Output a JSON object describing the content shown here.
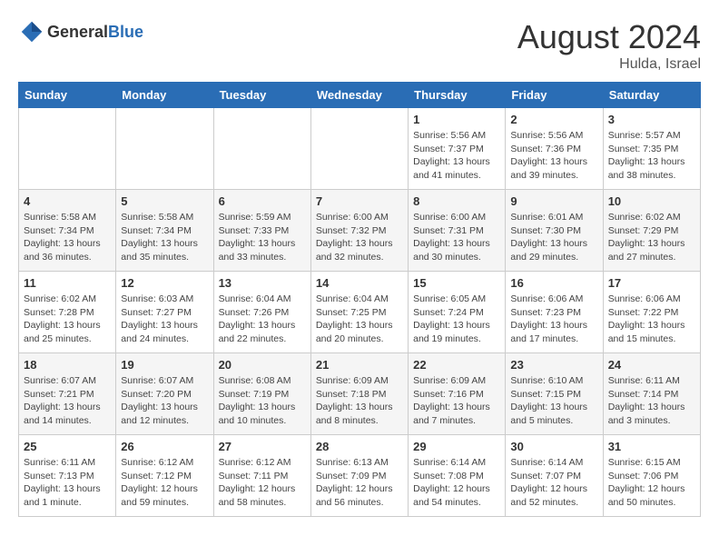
{
  "header": {
    "logo_general": "General",
    "logo_blue": "Blue",
    "month_year": "August 2024",
    "location": "Hulda, Israel"
  },
  "days_of_week": [
    "Sunday",
    "Monday",
    "Tuesday",
    "Wednesday",
    "Thursday",
    "Friday",
    "Saturday"
  ],
  "weeks": [
    [
      {
        "day": "",
        "empty": true
      },
      {
        "day": "",
        "empty": true
      },
      {
        "day": "",
        "empty": true
      },
      {
        "day": "",
        "empty": true
      },
      {
        "day": "1",
        "sunrise": "5:56 AM",
        "sunset": "7:37 PM",
        "daylight": "13 hours and 41 minutes."
      },
      {
        "day": "2",
        "sunrise": "5:56 AM",
        "sunset": "7:36 PM",
        "daylight": "13 hours and 39 minutes."
      },
      {
        "day": "3",
        "sunrise": "5:57 AM",
        "sunset": "7:35 PM",
        "daylight": "13 hours and 38 minutes."
      }
    ],
    [
      {
        "day": "4",
        "sunrise": "5:58 AM",
        "sunset": "7:34 PM",
        "daylight": "13 hours and 36 minutes."
      },
      {
        "day": "5",
        "sunrise": "5:58 AM",
        "sunset": "7:34 PM",
        "daylight": "13 hours and 35 minutes."
      },
      {
        "day": "6",
        "sunrise": "5:59 AM",
        "sunset": "7:33 PM",
        "daylight": "13 hours and 33 minutes."
      },
      {
        "day": "7",
        "sunrise": "6:00 AM",
        "sunset": "7:32 PM",
        "daylight": "13 hours and 32 minutes."
      },
      {
        "day": "8",
        "sunrise": "6:00 AM",
        "sunset": "7:31 PM",
        "daylight": "13 hours and 30 minutes."
      },
      {
        "day": "9",
        "sunrise": "6:01 AM",
        "sunset": "7:30 PM",
        "daylight": "13 hours and 29 minutes."
      },
      {
        "day": "10",
        "sunrise": "6:02 AM",
        "sunset": "7:29 PM",
        "daylight": "13 hours and 27 minutes."
      }
    ],
    [
      {
        "day": "11",
        "sunrise": "6:02 AM",
        "sunset": "7:28 PM",
        "daylight": "13 hours and 25 minutes."
      },
      {
        "day": "12",
        "sunrise": "6:03 AM",
        "sunset": "7:27 PM",
        "daylight": "13 hours and 24 minutes."
      },
      {
        "day": "13",
        "sunrise": "6:04 AM",
        "sunset": "7:26 PM",
        "daylight": "13 hours and 22 minutes."
      },
      {
        "day": "14",
        "sunrise": "6:04 AM",
        "sunset": "7:25 PM",
        "daylight": "13 hours and 20 minutes."
      },
      {
        "day": "15",
        "sunrise": "6:05 AM",
        "sunset": "7:24 PM",
        "daylight": "13 hours and 19 minutes."
      },
      {
        "day": "16",
        "sunrise": "6:06 AM",
        "sunset": "7:23 PM",
        "daylight": "13 hours and 17 minutes."
      },
      {
        "day": "17",
        "sunrise": "6:06 AM",
        "sunset": "7:22 PM",
        "daylight": "13 hours and 15 minutes."
      }
    ],
    [
      {
        "day": "18",
        "sunrise": "6:07 AM",
        "sunset": "7:21 PM",
        "daylight": "13 hours and 14 minutes."
      },
      {
        "day": "19",
        "sunrise": "6:07 AM",
        "sunset": "7:20 PM",
        "daylight": "13 hours and 12 minutes."
      },
      {
        "day": "20",
        "sunrise": "6:08 AM",
        "sunset": "7:19 PM",
        "daylight": "13 hours and 10 minutes."
      },
      {
        "day": "21",
        "sunrise": "6:09 AM",
        "sunset": "7:18 PM",
        "daylight": "13 hours and 8 minutes."
      },
      {
        "day": "22",
        "sunrise": "6:09 AM",
        "sunset": "7:16 PM",
        "daylight": "13 hours and 7 minutes."
      },
      {
        "day": "23",
        "sunrise": "6:10 AM",
        "sunset": "7:15 PM",
        "daylight": "13 hours and 5 minutes."
      },
      {
        "day": "24",
        "sunrise": "6:11 AM",
        "sunset": "7:14 PM",
        "daylight": "13 hours and 3 minutes."
      }
    ],
    [
      {
        "day": "25",
        "sunrise": "6:11 AM",
        "sunset": "7:13 PM",
        "daylight": "13 hours and 1 minute."
      },
      {
        "day": "26",
        "sunrise": "6:12 AM",
        "sunset": "7:12 PM",
        "daylight": "12 hours and 59 minutes."
      },
      {
        "day": "27",
        "sunrise": "6:12 AM",
        "sunset": "7:11 PM",
        "daylight": "12 hours and 58 minutes."
      },
      {
        "day": "28",
        "sunrise": "6:13 AM",
        "sunset": "7:09 PM",
        "daylight": "12 hours and 56 minutes."
      },
      {
        "day": "29",
        "sunrise": "6:14 AM",
        "sunset": "7:08 PM",
        "daylight": "12 hours and 54 minutes."
      },
      {
        "day": "30",
        "sunrise": "6:14 AM",
        "sunset": "7:07 PM",
        "daylight": "12 hours and 52 minutes."
      },
      {
        "day": "31",
        "sunrise": "6:15 AM",
        "sunset": "7:06 PM",
        "daylight": "12 hours and 50 minutes."
      }
    ]
  ],
  "labels": {
    "sunrise": "Sunrise:",
    "sunset": "Sunset:",
    "daylight": "Daylight:"
  }
}
